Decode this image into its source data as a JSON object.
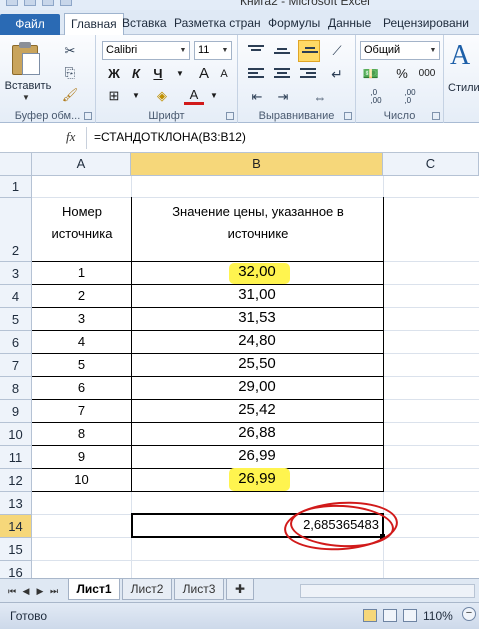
{
  "window": {
    "title": "Книга2 - Microsoft Excel"
  },
  "tabs": [
    "Файл",
    "Главная",
    "Вставка",
    "Разметка стран",
    "Формулы",
    "Данные",
    "Рецензировани"
  ],
  "active_tab": "Главная",
  "ribbon": {
    "clipboard": {
      "paste_label": "Вставить",
      "group_label": "Буфер обм..."
    },
    "font": {
      "name": "Calibri",
      "size": "11",
      "bold": "Ж",
      "italic": "К",
      "underline": "Ч",
      "grow": "A",
      "shrink": "A",
      "fontcolor": "A",
      "group_label": "Шрифт"
    },
    "alignment": {
      "group_label": "Выравнивание"
    },
    "number": {
      "format": "Общий",
      "percent": "%",
      "thousands": "000",
      "dec_inc": ",0\n,00",
      "dec_dec": ",00\n,0",
      "group_label": "Число"
    },
    "styles": {
      "label": "Стили"
    }
  },
  "formula_bar": {
    "name_box": "",
    "fx": "fx",
    "formula": "=СТАНДОТКЛОНА(B3:B12)"
  },
  "grid": {
    "columns": [
      "A",
      "B",
      "C"
    ],
    "rows": [
      "1",
      "2",
      "3",
      "4",
      "5",
      "6",
      "7",
      "8",
      "9",
      "10",
      "11",
      "12",
      "13",
      "14",
      "15",
      "16"
    ],
    "header_a": "Номер источника",
    "header_b": "Значение цены, указанное в источнике",
    "data": [
      {
        "a": "1",
        "b": "32,00"
      },
      {
        "a": "2",
        "b": "31,00"
      },
      {
        "a": "3",
        "b": "31,53"
      },
      {
        "a": "4",
        "b": "24,80"
      },
      {
        "a": "5",
        "b": "25,50"
      },
      {
        "a": "6",
        "b": "29,00"
      },
      {
        "a": "7",
        "b": "25,42"
      },
      {
        "a": "8",
        "b": "26,88"
      },
      {
        "a": "9",
        "b": "26,99"
      },
      {
        "a": "10",
        "b": "26,99"
      }
    ],
    "result": "2,685365483",
    "selected_cell": "B14"
  },
  "sheets": [
    "Лист1",
    "Лист2",
    "Лист3"
  ],
  "active_sheet": "Лист1",
  "status": {
    "text": "Готово",
    "zoom": "110%"
  },
  "colors": {
    "highlight": "#fff44f",
    "circle": "#d11a1a",
    "accent": "#2a6ab4",
    "selected_header": "#f6d77a"
  }
}
